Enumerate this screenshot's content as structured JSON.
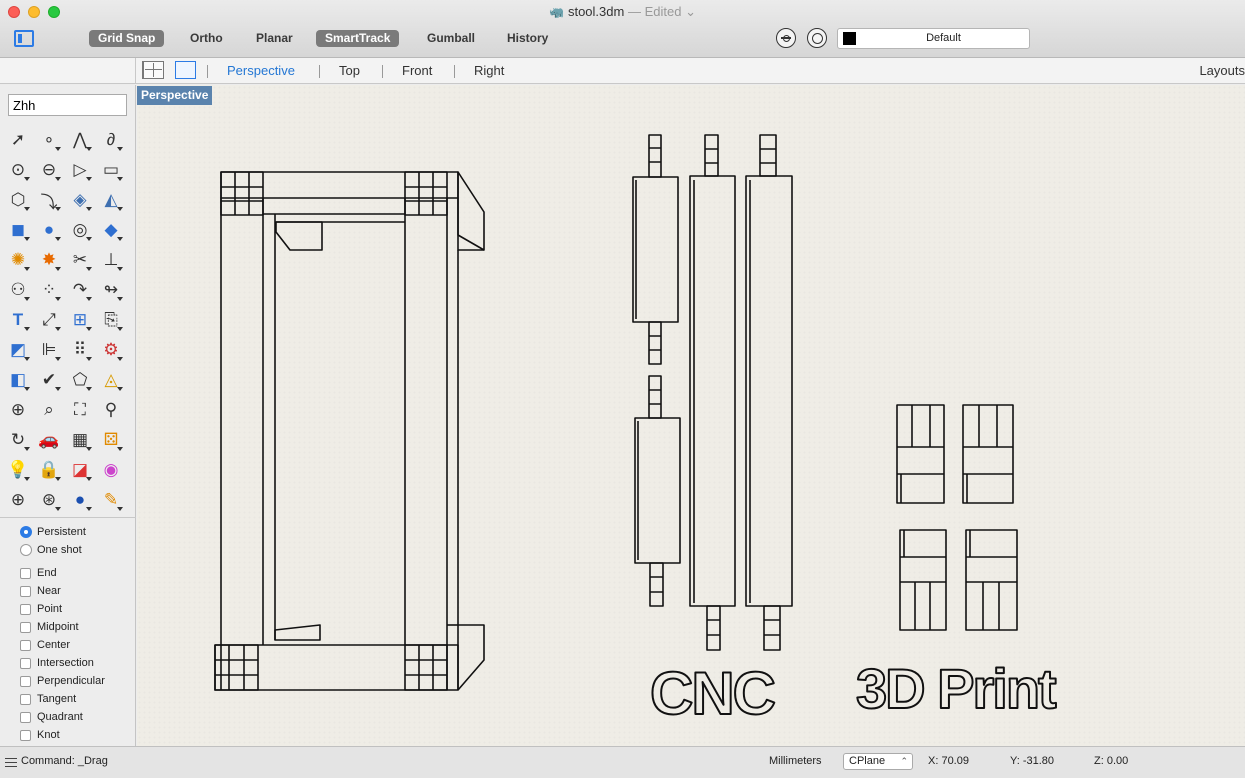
{
  "window": {
    "title": "stool.3dm",
    "status": "— Edited",
    "chevron": "⌄"
  },
  "toolbar": {
    "modes": [
      {
        "label": "Grid Snap",
        "on": true
      },
      {
        "label": "Ortho",
        "on": false
      },
      {
        "label": "Planar",
        "on": false
      },
      {
        "label": "SmartTrack",
        "on": true
      },
      {
        "label": "Gumball",
        "on": false
      },
      {
        "label": "History",
        "on": false
      }
    ],
    "layer": "Default"
  },
  "viewport_tabs": {
    "tabs": [
      "Perspective",
      "Top",
      "Front",
      "Right"
    ],
    "active": "Perspective",
    "layouts": "Layouts"
  },
  "left_panel": {
    "command_input": "Zhh",
    "tool_icons": [
      "select-arrow-icon",
      "point-icon",
      "polyline-icon",
      "curve-icon",
      "circle-icon",
      "ellipse-icon",
      "arc-icon",
      "rectangle-icon",
      "polygon-icon",
      "fillet-curve-icon",
      "surface-from-points-icon",
      "loft-icon",
      "box-solid-icon",
      "sphere-icon",
      "cylinder-icon",
      "surface-edit-icon",
      "explode-icon",
      "boolean-icon",
      "trim-icon",
      "split-icon",
      "group-icon",
      "array-icon",
      "rotate-icon",
      "rebuild-icon",
      "text-icon",
      "transform-icon",
      "array-grid-icon",
      "edit-icon",
      "solid-edit-icon",
      "dimension-icon",
      "grid-array-icon",
      "properties-icon",
      "analyze-icon",
      "check-icon",
      "render-surface-icon",
      "layer-material-icon",
      "zoom-window-icon",
      "zoom-selected-icon",
      "zoom-extents-icon",
      "zoom-icon",
      "rotate-view-icon",
      "car-icon",
      "texture-map-icon",
      "rendering-icon",
      "light-bulb-icon",
      "lock-icon",
      "materials-icon",
      "color-wheel-icon",
      "wireframe-sphere-icon",
      "mesh-sphere-icon",
      "shaded-sphere-icon",
      "pencil-icon"
    ],
    "drag_modes": [
      {
        "label": "Persistent",
        "selected": true
      },
      {
        "label": "One shot",
        "selected": false
      }
    ],
    "osnaps": [
      {
        "label": "End",
        "checked": false
      },
      {
        "label": "Near",
        "checked": false
      },
      {
        "label": "Point",
        "checked": false
      },
      {
        "label": "Midpoint",
        "checked": false
      },
      {
        "label": "Center",
        "checked": false
      },
      {
        "label": "Intersection",
        "checked": false
      },
      {
        "label": "Perpendicular",
        "checked": false
      },
      {
        "label": "Tangent",
        "checked": false
      },
      {
        "label": "Quadrant",
        "checked": false
      },
      {
        "label": "Knot",
        "checked": false
      }
    ]
  },
  "viewport": {
    "label": "Perspective",
    "text_objects": {
      "cnc": "CNC",
      "print": "3D Print"
    }
  },
  "status": {
    "command": "Command: _Drag",
    "units": "Millimeters",
    "cplane": "CPlane",
    "x": "X: 70.09",
    "y": "Y: -31.80",
    "z": "Z: 0.00"
  }
}
